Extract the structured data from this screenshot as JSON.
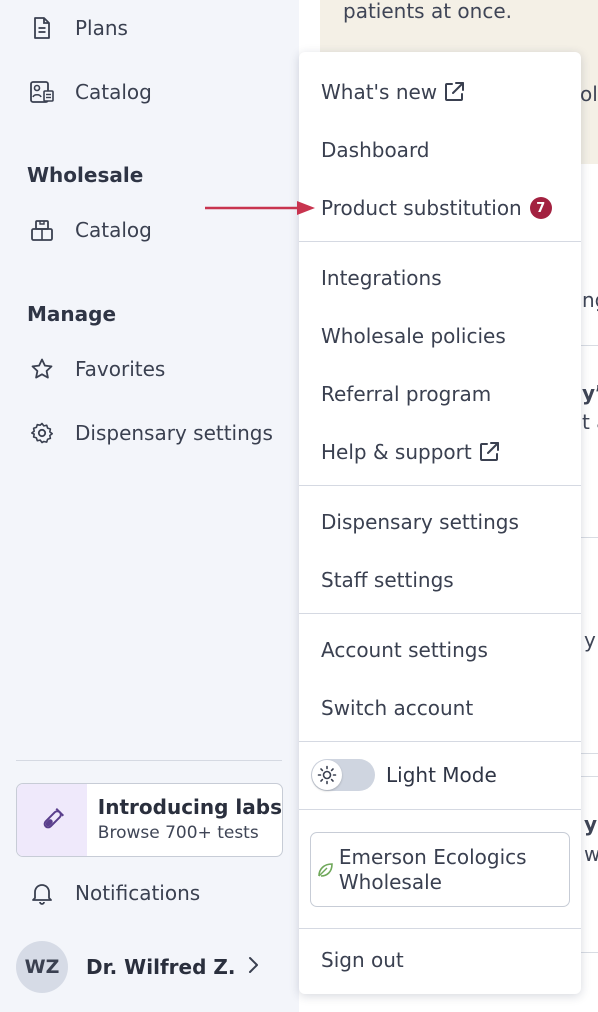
{
  "sidebar": {
    "items_top": [
      {
        "label": "Plans",
        "icon": "document-icon"
      },
      {
        "label": "Catalog",
        "icon": "patient-catalog-icon"
      }
    ],
    "wholesale": {
      "title": "Wholesale",
      "items": [
        {
          "label": "Catalog",
          "icon": "wholesale-box-icon"
        }
      ]
    },
    "manage": {
      "title": "Manage",
      "items": [
        {
          "label": "Favorites",
          "icon": "star-icon"
        },
        {
          "label": "Dispensary settings",
          "icon": "gear-icon"
        }
      ]
    },
    "promo": {
      "title": "Introducing labs",
      "subtitle": "Browse 700+ tests",
      "icon": "test-tube-icon"
    },
    "notifications": {
      "label": "Notifications",
      "icon": "bell-icon"
    },
    "user": {
      "initials": "WZ",
      "name": "Dr. Wilfred Z..."
    }
  },
  "background": {
    "banner_text": "patients at once.",
    "fragments": [
      "ola",
      "ng",
      "y’r",
      "t a",
      "y",
      "y",
      "w"
    ]
  },
  "menu": {
    "whats_new": "What's new",
    "dashboard": "Dashboard",
    "product_substitution": "Product substitution",
    "product_substitution_badge": "7",
    "integrations": "Integrations",
    "wholesale_policies": "Wholesale policies",
    "referral_program": "Referral program",
    "help_support": "Help & support",
    "dispensary_settings": "Dispensary settings",
    "staff_settings": "Staff settings",
    "account_settings": "Account settings",
    "switch_account": "Switch account",
    "light_mode": "Light Mode",
    "store_name": "Emerson Ecologics Wholesale",
    "sign_out": "Sign out"
  },
  "colors": {
    "badge": "#a32140",
    "annotation_arrow": "#c8344f",
    "promo_icon_bg": "#efe9fb",
    "banner_bg": "#f4f0e6"
  }
}
